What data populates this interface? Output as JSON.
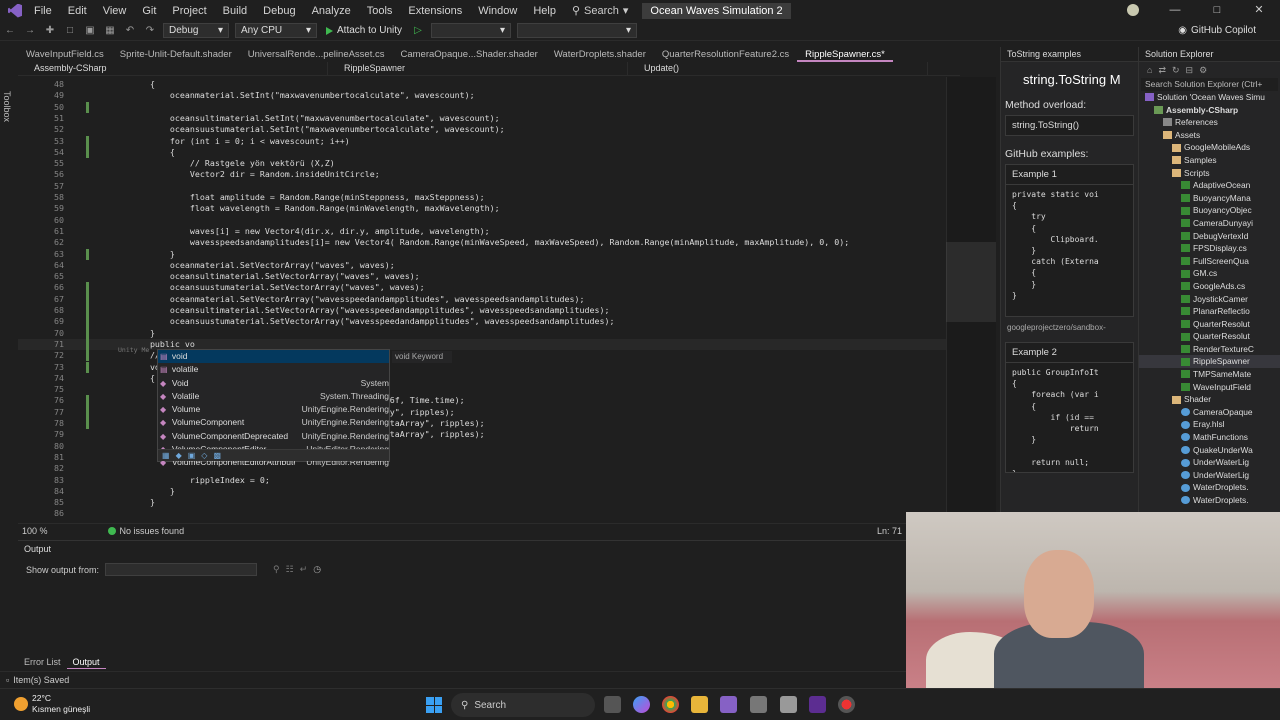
{
  "menu": {
    "items": [
      "File",
      "Edit",
      "View",
      "Git",
      "Project",
      "Build",
      "Debug",
      "Analyze",
      "Tools",
      "Extensions",
      "Window",
      "Help"
    ],
    "search_label": "Search",
    "solution_title": "Ocean Waves Simulation 2"
  },
  "toolbar": {
    "config": "Debug",
    "platform": "Any CPU",
    "run_label": "Attach to Unity",
    "copilot_label": "GitHub Copilot"
  },
  "toolbox_label": "Toolbox",
  "doc_tabs": [
    "WaveInputField.cs",
    "Sprite-Unlit-Default.shader",
    "UniversalRende...pelineAsset.cs",
    "CameraOpaque...Shader.shader",
    "WaterDroplets.shader",
    "QuarterResolutionFeature2.cs",
    "RippleSpawner.cs*"
  ],
  "navbar": {
    "project": "Assembly-CSharp",
    "class": "RippleSpawner",
    "member": "Update()"
  },
  "code": {
    "lines": [
      {
        "n": "48",
        "t": "            {"
      },
      {
        "n": "49",
        "t": "                oceanmaterial.SetInt(\"maxwavenumbertocalculate\", wavescount);"
      },
      {
        "n": "50",
        "t": ""
      },
      {
        "n": "51",
        "t": "                oceansultimaterial.SetInt(\"maxwavenumbertocalculate\", wavescount);"
      },
      {
        "n": "52",
        "t": "                oceansuustumaterial.SetInt(\"maxwavenumbertocalculate\", wavescount);"
      },
      {
        "n": "53",
        "t": "                for (int i = 0; i < wavescount; i++)"
      },
      {
        "n": "54",
        "t": "                {"
      },
      {
        "n": "55",
        "t": "                    // Rastgele yön vektörü (X,Z)"
      },
      {
        "n": "56",
        "t": "                    Vector2 dir = Random.insideUnitCircle;"
      },
      {
        "n": "57",
        "t": ""
      },
      {
        "n": "58",
        "t": "                    float amplitude = Random.Range(minSteppness, maxSteppness);"
      },
      {
        "n": "59",
        "t": "                    float wavelength = Random.Range(minWavelength, maxWavelength);"
      },
      {
        "n": "60",
        "t": ""
      },
      {
        "n": "61",
        "t": "                    waves[i] = new Vector4(dir.x, dir.y, amplitude, wavelength);"
      },
      {
        "n": "62",
        "t": "                    wavesspeedsandamplitudes[i]= new Vector4( Random.Range(minWaveSpeed, maxWaveSpeed), Random.Range(minAmplitude, maxAmplitude), 0, 0);"
      },
      {
        "n": "63",
        "t": "                }"
      },
      {
        "n": "64",
        "t": "                oceanmaterial.SetVectorArray(\"waves\", waves);"
      },
      {
        "n": "65",
        "t": "                oceansultimaterial.SetVectorArray(\"waves\", waves);"
      },
      {
        "n": "66",
        "t": "                oceansuustumaterial.SetVectorArray(\"waves\", waves);"
      },
      {
        "n": "67",
        "t": "                oceanmaterial.SetVectorArray(\"wavesspeedandampplitudes\", wavesspeedsandamplitudes);"
      },
      {
        "n": "68",
        "t": "                oceansultimaterial.SetVectorArray(\"wavesspeedandampplitudes\", wavesspeedsandamplitudes);"
      },
      {
        "n": "69",
        "t": "                oceansuustumaterial.SetVectorArray(\"wavesspeedandampplitudes\", wavesspeedsandamplitudes);"
      },
      {
        "n": "70",
        "t": "            }"
      },
      {
        "n": "71",
        "t": "            public vo"
      },
      {
        "n": "72",
        "t": "            // Upda"
      },
      {
        "n": "73",
        "t": "            void Up"
      },
      {
        "n": "74",
        "t": "            {"
      },
      {
        "n": "75",
        "t": "                if"
      },
      {
        "n": "76",
        "t": "                                                            6f, Time.time);"
      },
      {
        "n": "77",
        "t": "                                                            y\", ripples);"
      },
      {
        "n": "78",
        "t": "                                                            taArray\", ripples);"
      },
      {
        "n": "79",
        "t": "                                                            taArray\", ripples);"
      },
      {
        "n": "80",
        "t": ""
      },
      {
        "n": "81",
        "t": ""
      },
      {
        "n": "82",
        "t": ""
      },
      {
        "n": "83",
        "t": "                    rippleIndex = 0;"
      },
      {
        "n": "84",
        "t": "                }"
      },
      {
        "n": "85",
        "t": "            }"
      },
      {
        "n": "86",
        "t": ""
      }
    ],
    "hint_text": "Unity Me"
  },
  "intellisense": {
    "items": [
      {
        "label": "void",
        "ns": ""
      },
      {
        "label": "volatile",
        "ns": ""
      },
      {
        "label": "Void",
        "ns": "System"
      },
      {
        "label": "Volatile",
        "ns": "System.Threading"
      },
      {
        "label": "Volume",
        "ns": "UnityEngine.Rendering"
      },
      {
        "label": "VolumeComponent",
        "ns": "UnityEngine.Rendering"
      },
      {
        "label": "VolumeComponentDeprecated",
        "ns": "UnityEngine.Rendering"
      },
      {
        "label": "VolumeComponentEditor",
        "ns": "UnityEditor.Rendering"
      },
      {
        "label": "VolumeComponentEditorAttribute",
        "ns": "UnityEditor.Rendering"
      }
    ],
    "tooltip": "void Keyword"
  },
  "editor_status": {
    "zoom": "100 %",
    "issues": "No issues found",
    "position": "Ln: 71"
  },
  "tostring_panel": {
    "title": "ToString examples",
    "heading": "string.ToString M",
    "method_overload_label": "Method overload:",
    "method_overload_value": "string.ToString()",
    "github_label": "GitHub examples:",
    "example1_label": "Example 1",
    "example1_code": "private static voi\n{\n    try\n    {\n        Clipboard.\n    }\n    catch (Externa\n    {\n    }\n}",
    "example1_link": "googleprojectzero/sandbox-",
    "example2_label": "Example 2",
    "example2_code": "public GroupInfoIt\n{\n    foreach (var i\n    {\n        if (id ==\n            return\n    }\n\n    return null;\n}"
  },
  "solution_explorer": {
    "title": "Solution Explorer",
    "search_placeholder": "Search Solution Explorer (Ctrl+",
    "items": [
      {
        "label": "Solution 'Ocean Waves Simu",
        "icon": "sol",
        "indent": 0,
        "bold": false
      },
      {
        "label": "Assembly-CSharp",
        "icon": "proj",
        "indent": 1,
        "bold": true
      },
      {
        "label": "References",
        "icon": "ref",
        "indent": 2,
        "bold": false
      },
      {
        "label": "Assets",
        "icon": "folder",
        "indent": 2,
        "bold": false
      },
      {
        "label": "GoogleMobileAds",
        "icon": "folder",
        "indent": 3,
        "bold": false
      },
      {
        "label": "Samples",
        "icon": "folder",
        "indent": 3,
        "bold": false
      },
      {
        "label": "Scripts",
        "icon": "folder",
        "indent": 3,
        "bold": false
      },
      {
        "label": "AdaptiveOcean",
        "icon": "cs",
        "indent": 4,
        "bold": false
      },
      {
        "label": "BuoyancyMana",
        "icon": "cs",
        "indent": 4,
        "bold": false
      },
      {
        "label": "BuoyancyObjec",
        "icon": "cs",
        "indent": 4,
        "bold": false
      },
      {
        "label": "CameraDunyayi",
        "icon": "cs",
        "indent": 4,
        "bold": false
      },
      {
        "label": "DebugVertexId",
        "icon": "cs",
        "indent": 4,
        "bold": false
      },
      {
        "label": "FPSDisplay.cs",
        "icon": "cs",
        "indent": 4,
        "bold": false
      },
      {
        "label": "FullScreenQua",
        "icon": "cs",
        "indent": 4,
        "bold": false
      },
      {
        "label": "GM.cs",
        "icon": "cs",
        "indent": 4,
        "bold": false
      },
      {
        "label": "GoogleAds.cs",
        "icon": "cs",
        "indent": 4,
        "bold": false
      },
      {
        "label": "JoystickCamer",
        "icon": "cs",
        "indent": 4,
        "bold": false
      },
      {
        "label": "PlanarReflectio",
        "icon": "cs",
        "indent": 4,
        "bold": false
      },
      {
        "label": "QuarterResolut",
        "icon": "cs",
        "indent": 4,
        "bold": false
      },
      {
        "label": "QuarterResolut",
        "icon": "cs",
        "indent": 4,
        "bold": false
      },
      {
        "label": "RenderTextureC",
        "icon": "cs",
        "indent": 4,
        "bold": false
      },
      {
        "label": "RippleSpawner",
        "icon": "cs",
        "indent": 4,
        "bold": false,
        "selected": true
      },
      {
        "label": "TMPSameMate",
        "icon": "cs",
        "indent": 4,
        "bold": false
      },
      {
        "label": "WaveInputField",
        "icon": "cs",
        "indent": 4,
        "bold": false
      },
      {
        "label": "Shader",
        "icon": "folder",
        "indent": 3,
        "bold": false
      },
      {
        "label": "CameraOpaque",
        "icon": "shader",
        "indent": 4,
        "bold": false
      },
      {
        "label": "Eray.hlsl",
        "icon": "shader",
        "indent": 4,
        "bold": false
      },
      {
        "label": "MathFunctions",
        "icon": "shader",
        "indent": 4,
        "bold": false
      },
      {
        "label": "QuakeUnderWa",
        "icon": "shader",
        "indent": 4,
        "bold": false
      },
      {
        "label": "UnderWaterLig",
        "icon": "shader",
        "indent": 4,
        "bold": false
      },
      {
        "label": "UnderWaterLig",
        "icon": "shader",
        "indent": 4,
        "bold": false
      },
      {
        "label": "WaterDroplets.",
        "icon": "shader",
        "indent": 4,
        "bold": false
      },
      {
        "label": "WaterDroplets.",
        "icon": "shader",
        "indent": 4,
        "bold": false
      }
    ]
  },
  "output": {
    "title": "Output",
    "show_from_label": "Show output from:",
    "tabs": [
      "Error List",
      "Output"
    ]
  },
  "statusbar": {
    "text": "Item(s) Saved"
  },
  "taskbar": {
    "temperature": "22°C",
    "weather": "Kısmen güneşli",
    "search_label": "Search"
  }
}
